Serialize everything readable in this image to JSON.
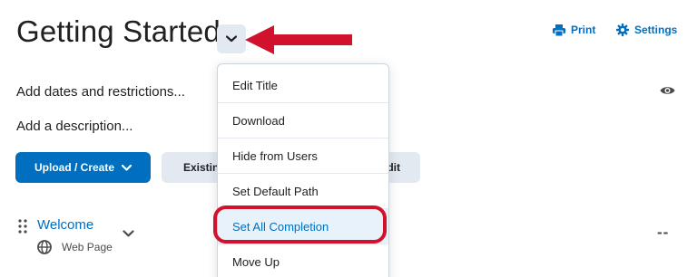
{
  "page": {
    "title": "Getting Started"
  },
  "top_actions": {
    "print_label": "Print",
    "settings_label": "Settings"
  },
  "content": {
    "dates_label": "Add dates and restrictions...",
    "description_label": "Add a description..."
  },
  "buttons": {
    "upload_create_label": "Upload / Create",
    "existing_label": "Existing",
    "edit_label": "dit"
  },
  "menu": {
    "items": [
      {
        "label": "Edit Title"
      },
      {
        "label": "Download"
      },
      {
        "label": "Hide from Users"
      },
      {
        "label": "Set Default Path"
      },
      {
        "label": "Set All Completion"
      },
      {
        "label": "Move Up"
      }
    ]
  },
  "topic": {
    "title": "Welcome",
    "type": "Web Page",
    "completion": "--"
  },
  "colors": {
    "accent": "#006fbf",
    "annotation": "#d2112d",
    "button_secondary": "#e3e9f1"
  },
  "icons": [
    "chevron-down-icon",
    "print-icon",
    "gear-icon",
    "eye-icon",
    "drag-handle-icon",
    "globe-icon",
    "annotation-arrow"
  ]
}
